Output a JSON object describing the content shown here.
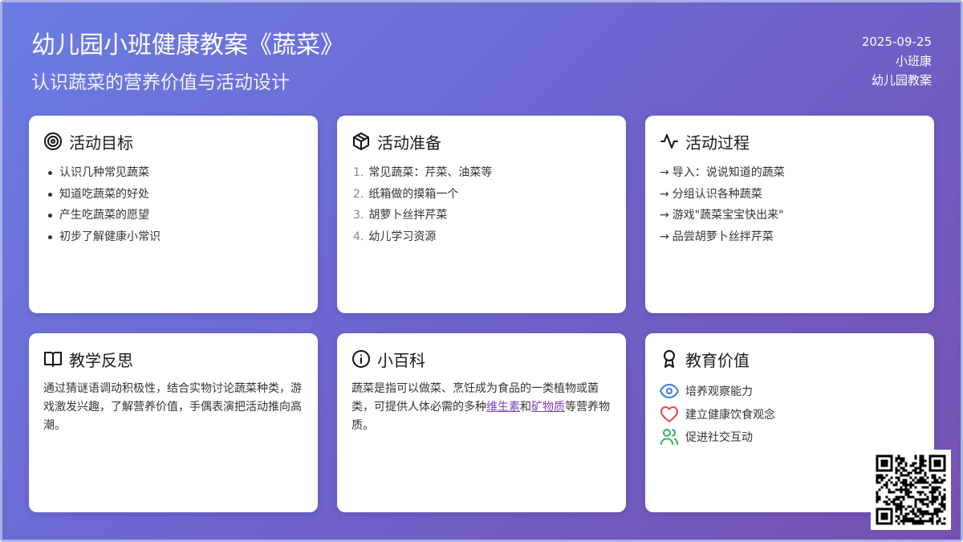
{
  "header": {
    "title": "幼儿园小班健康教案《蔬菜》",
    "subtitle": "认识蔬菜的营养价值与活动设计",
    "date": "2025-09-25",
    "author": "小班康",
    "category": "幼儿园教案"
  },
  "cards": {
    "goals": {
      "title": "活动目标",
      "icon": "target-icon",
      "items": [
        "认识几种常见蔬菜",
        "知道吃蔬菜的好处",
        "产生吃蔬菜的愿望",
        "初步了解健康小常识"
      ]
    },
    "prep": {
      "title": "活动准备",
      "icon": "box-icon",
      "items": [
        {
          "num": "1.",
          "text": "常见蔬菜：芹菜、油菜等"
        },
        {
          "num": "2.",
          "text": "纸箱做的摸箱一个"
        },
        {
          "num": "3.",
          "text": "胡萝卜丝拌芹菜"
        },
        {
          "num": "4.",
          "text": "幼儿学习资源"
        }
      ]
    },
    "process": {
      "title": "活动过程",
      "icon": "activity-icon",
      "arrow": "→",
      "items": [
        "导入：说说知道的蔬菜",
        "分组认识各种蔬菜",
        "游戏\"蔬菜宝宝快出来\"",
        "品尝胡萝卜丝拌芹菜"
      ]
    },
    "reflection": {
      "title": "教学反思",
      "icon": "book-open-icon",
      "text": "通过猜谜语调动积极性，结合实物讨论蔬菜种类，游戏激发兴趣，了解营养价值，手偶表演把活动推向高潮。"
    },
    "wiki": {
      "title": "小百科",
      "icon": "info-icon",
      "text_1": "蔬菜是指可以做菜、烹饪成为食品的一类植物或菌类，可提供人体必需的多种",
      "link_1": "维生素",
      "text_2": "和",
      "link_2": "矿物质",
      "text_3": "等营养物质。"
    },
    "value": {
      "title": "教育价值",
      "icon": "award-icon",
      "items": [
        {
          "text": "培养观察能力",
          "icon": "eye-icon",
          "color": "#3b7dd8"
        },
        {
          "text": "建立健康饮食观念",
          "icon": "heart-icon",
          "color": "#e5484d"
        },
        {
          "text": "促进社交互动",
          "icon": "users-icon",
          "color": "#2fb36b"
        }
      ]
    }
  },
  "colors": {
    "bg_start": "#6a7de3",
    "bg_end": "#7650b0",
    "link": "#7b3fc4"
  }
}
